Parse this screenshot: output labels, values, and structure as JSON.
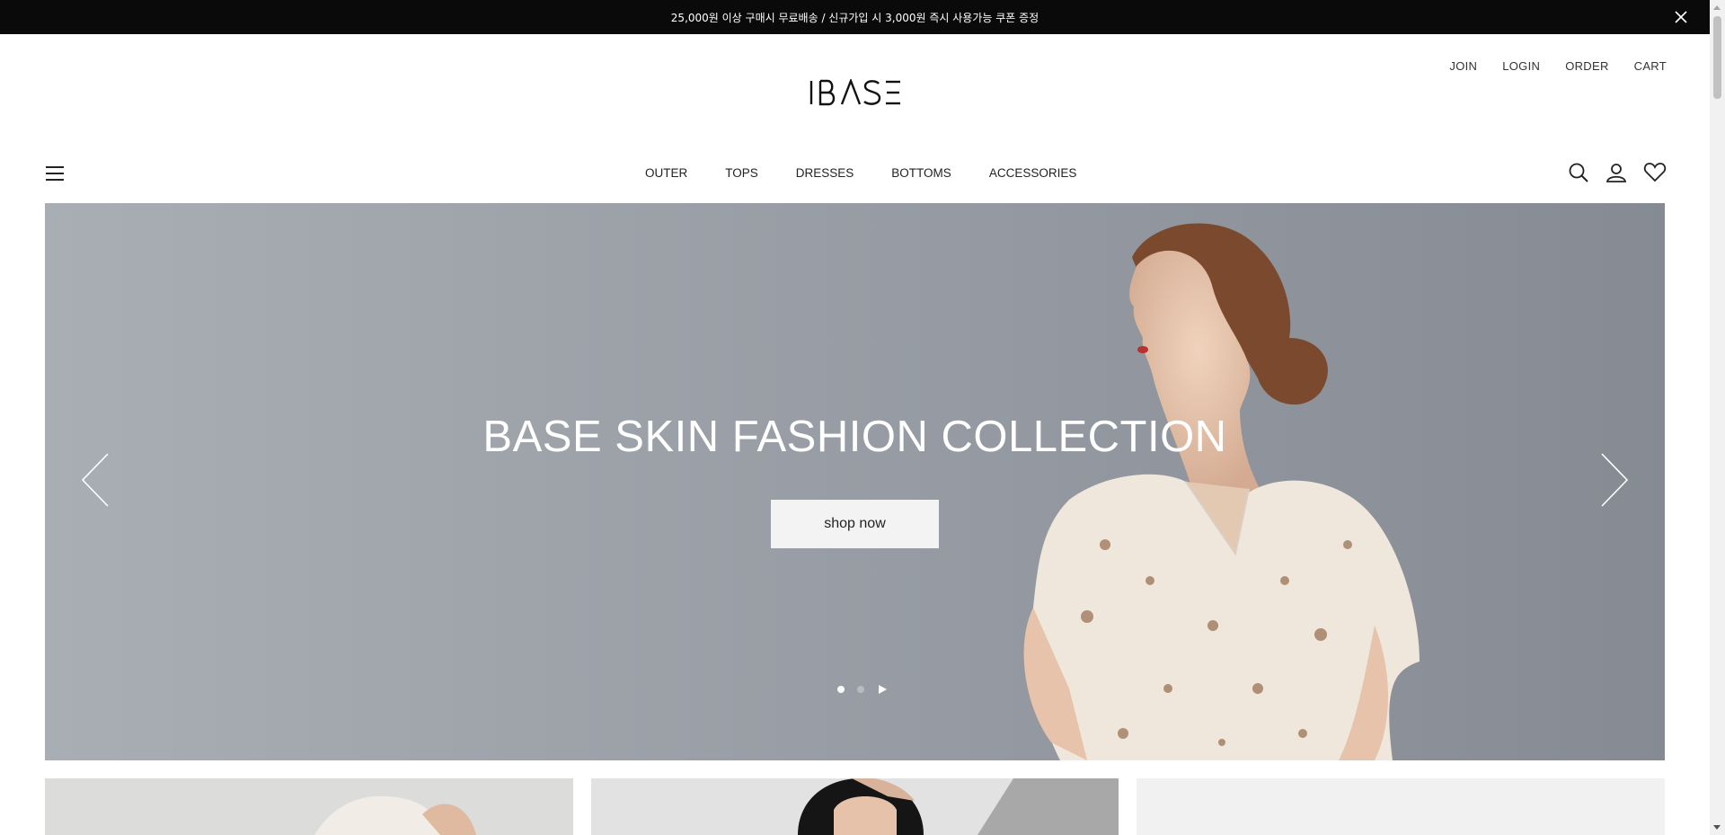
{
  "announcement": {
    "text": "25,000원 이상 구매시 무료배송 / 신규가입 시 3,000원 즉시 사용가능 쿠폰 증정",
    "close_icon": "close-icon"
  },
  "utility_links": [
    "JOIN",
    "LOGIN",
    "ORDER",
    "CART"
  ],
  "logo": {
    "text": "IBASE"
  },
  "nav": {
    "items": [
      "OUTER",
      "TOPS",
      "DRESSES",
      "BOTTOMS",
      "ACCESSORIES"
    ],
    "menu_icon": "hamburger-menu-icon",
    "right_icons": [
      "search-icon",
      "user-icon",
      "heart-icon"
    ]
  },
  "hero": {
    "title": "BASE SKIN FASHION COLLECTION",
    "button_label": "shop now",
    "slide_count": 2,
    "active_slide": 1,
    "colors": {
      "background": "#959aa1",
      "button_bg": "#f3f3f3",
      "title": "#ffffff"
    }
  },
  "colors": {
    "topbar": "#0a0a0a",
    "text": "#222222"
  }
}
